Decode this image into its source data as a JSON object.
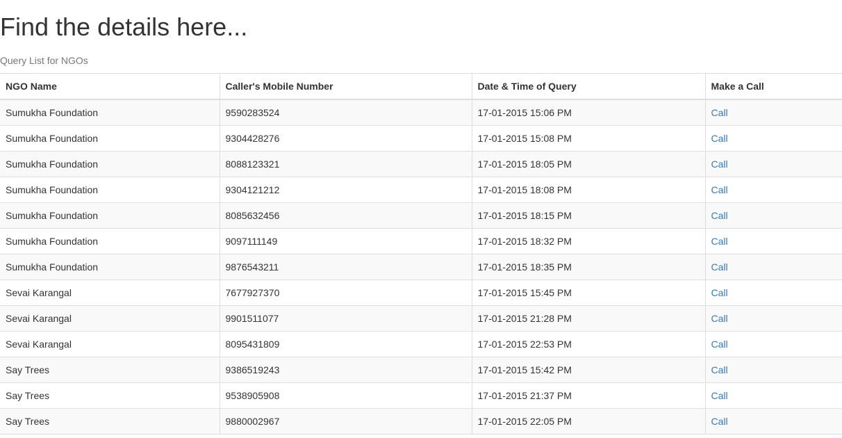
{
  "page": {
    "title": "Find the details here...",
    "caption": "Query List for NGOs"
  },
  "table": {
    "headers": {
      "ngo_name": "NGO Name",
      "mobile": "Caller's Mobile Number",
      "datetime": "Date & Time of Query",
      "call": "Make a Call"
    },
    "rows": [
      {
        "ngo_name": "Sumukha Foundation",
        "mobile": "9590283524",
        "datetime": "17-01-2015 15:06 PM",
        "call": "Call"
      },
      {
        "ngo_name": "Sumukha Foundation",
        "mobile": "9304428276",
        "datetime": "17-01-2015 15:08 PM",
        "call": "Call"
      },
      {
        "ngo_name": "Sumukha Foundation",
        "mobile": "8088123321",
        "datetime": "17-01-2015 18:05 PM",
        "call": "Call"
      },
      {
        "ngo_name": "Sumukha Foundation",
        "mobile": "9304121212",
        "datetime": "17-01-2015 18:08 PM",
        "call": "Call"
      },
      {
        "ngo_name": "Sumukha Foundation",
        "mobile": "8085632456",
        "datetime": "17-01-2015 18:15 PM",
        "call": "Call"
      },
      {
        "ngo_name": "Sumukha Foundation",
        "mobile": "9097111149",
        "datetime": "17-01-2015 18:32 PM",
        "call": "Call"
      },
      {
        "ngo_name": "Sumukha Foundation",
        "mobile": "9876543211",
        "datetime": "17-01-2015 18:35 PM",
        "call": "Call"
      },
      {
        "ngo_name": "Sevai Karangal",
        "mobile": "7677927370",
        "datetime": "17-01-2015 15:45 PM",
        "call": "Call"
      },
      {
        "ngo_name": "Sevai Karangal",
        "mobile": "9901511077",
        "datetime": "17-01-2015 21:28 PM",
        "call": "Call"
      },
      {
        "ngo_name": "Sevai Karangal",
        "mobile": "8095431809",
        "datetime": "17-01-2015 22:53 PM",
        "call": "Call"
      },
      {
        "ngo_name": "Say Trees",
        "mobile": "9386519243",
        "datetime": "17-01-2015 15:42 PM",
        "call": "Call"
      },
      {
        "ngo_name": "Say Trees",
        "mobile": "9538905908",
        "datetime": "17-01-2015 21:37 PM",
        "call": "Call"
      },
      {
        "ngo_name": "Say Trees",
        "mobile": "9880002967",
        "datetime": "17-01-2015 22:05 PM",
        "call": "Call"
      }
    ]
  },
  "colors": {
    "link": "#337ab7",
    "text": "#333333",
    "muted": "#777777",
    "stripe": "#f9f9f9",
    "border": "#dddddd"
  }
}
